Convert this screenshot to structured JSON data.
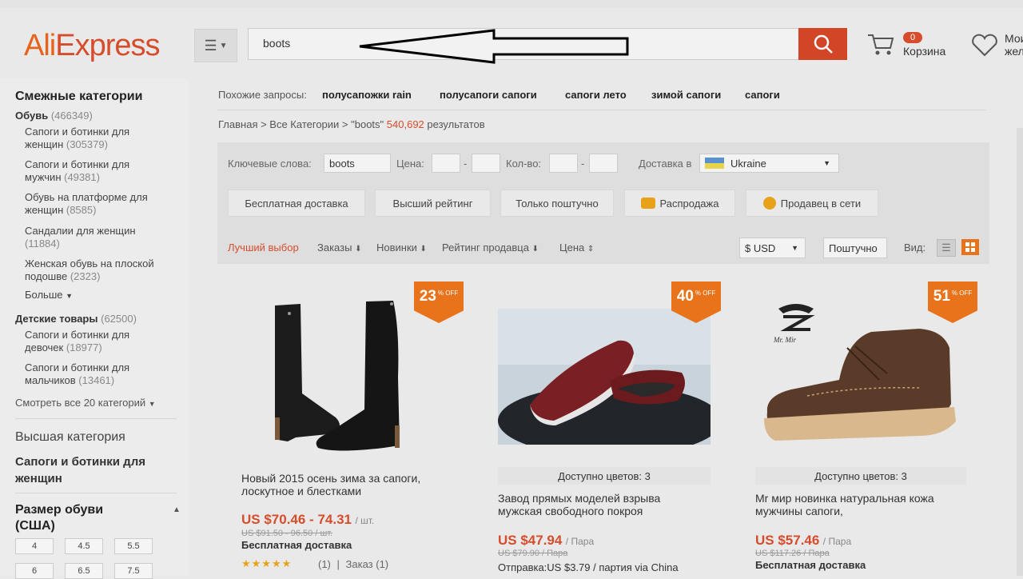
{
  "header": {
    "logo": "AliExpress",
    "search_value": "boots",
    "cart_count": "0",
    "cart_label": "Корзина",
    "wishlist_label": "Мои жела"
  },
  "sidebar": {
    "related_title": "Смежные категории",
    "shoes": {
      "label": "Обувь",
      "count": "(466349)"
    },
    "shoe_items": [
      {
        "label": "Сапоги и ботинки для женщин",
        "count": "(305379)"
      },
      {
        "label": "Сапоги и ботинки для мужчин",
        "count": "(49381)"
      },
      {
        "label": "Обувь на платформе для женщин",
        "count": "(8585)"
      },
      {
        "label": "Сандалии для женщин",
        "count": "(11884)"
      },
      {
        "label": "Женская обувь на плоской подошве",
        "count": "(2323)"
      }
    ],
    "more_label": "Больше",
    "kids": {
      "label": "Детские товары",
      "count": "(62500)"
    },
    "kids_items": [
      {
        "label": "Сапоги и ботинки для девочек",
        "count": "(18977)"
      },
      {
        "label": "Сапоги и ботинки для мальчиков",
        "count": "(13461)"
      }
    ],
    "see_all": "Смотреть все 20 категорий",
    "top_category_title": "Высшая категория",
    "top_category_value": "Сапоги и ботинки для женщин",
    "size_title": "Размер обуви (США)",
    "sizes": [
      "4",
      "4.5",
      "5.5",
      "6",
      "6.5",
      "7.5"
    ]
  },
  "main": {
    "related_label": "Похожие запросы:",
    "related_links": [
      "полусапожки rain",
      "полусапоги сапоги",
      "сапоги лето",
      "зимой сапоги",
      "сапоги"
    ],
    "breadcrumb": "Главная > Все Категории > \"boots\"",
    "result_count": "540,692",
    "result_label": "результатов",
    "filters": {
      "keywords_label": "Ключевые слова:",
      "keywords_value": "boots",
      "price_label": "Цена:",
      "qty_label": "Кол-во:",
      "delivery_label": "Доставка в",
      "delivery_value": "Ukraine",
      "chips": [
        "Бесплатная доставка",
        "Высший рейтинг",
        "Только поштучно",
        "Распродажа",
        "Продавец в сети"
      ]
    },
    "sort": {
      "best": "Лучший выбор",
      "orders": "Заказы",
      "new": "Новинки",
      "seller_rating": "Рейтинг продавца",
      "price": "Цена",
      "currency": "$ USD",
      "unit": "Поштучно",
      "view_label": "Вид:"
    },
    "products": [
      {
        "discount": "23",
        "off": "% OFF",
        "colors": "",
        "title": "Новый 2015 осень зима за сапоги, лоскутное и блестками",
        "price": "US $70.46 - 74.31",
        "unit": "/ шт.",
        "old_price": "US $91.50 - 96.50 / шт.",
        "shipping": "Бесплатная доставка",
        "rating_count": "(1)",
        "orders": "Заказ (1)"
      },
      {
        "discount": "40",
        "off": "% OFF",
        "colors": "Доступно цветов: 3",
        "title": "Завод прямых моделей взрыва мужская свободного покроя",
        "price": "US $47.94",
        "unit": "/ Пара",
        "old_price": "US $79.90 / Пара",
        "shipping": "Отправка:US $3.79 / партия via China",
        "rating_count": "",
        "orders": ""
      },
      {
        "discount": "51",
        "off": "% OFF",
        "colors": "Доступно цветов: 3",
        "title": "Mr мир новинка натуральная кожа мужчины сапоги,",
        "price": "US $57.46",
        "unit": "/ Пара",
        "old_price": "US $117.26 / Пара",
        "shipping": "Бесплатная доставка",
        "rating_count": "",
        "orders": ""
      }
    ],
    "brand_logo_text": "Mr. Mir"
  },
  "colors": {
    "accent": "#d64d2b",
    "badge": "#e8731a",
    "search_btn": "#d24527"
  }
}
